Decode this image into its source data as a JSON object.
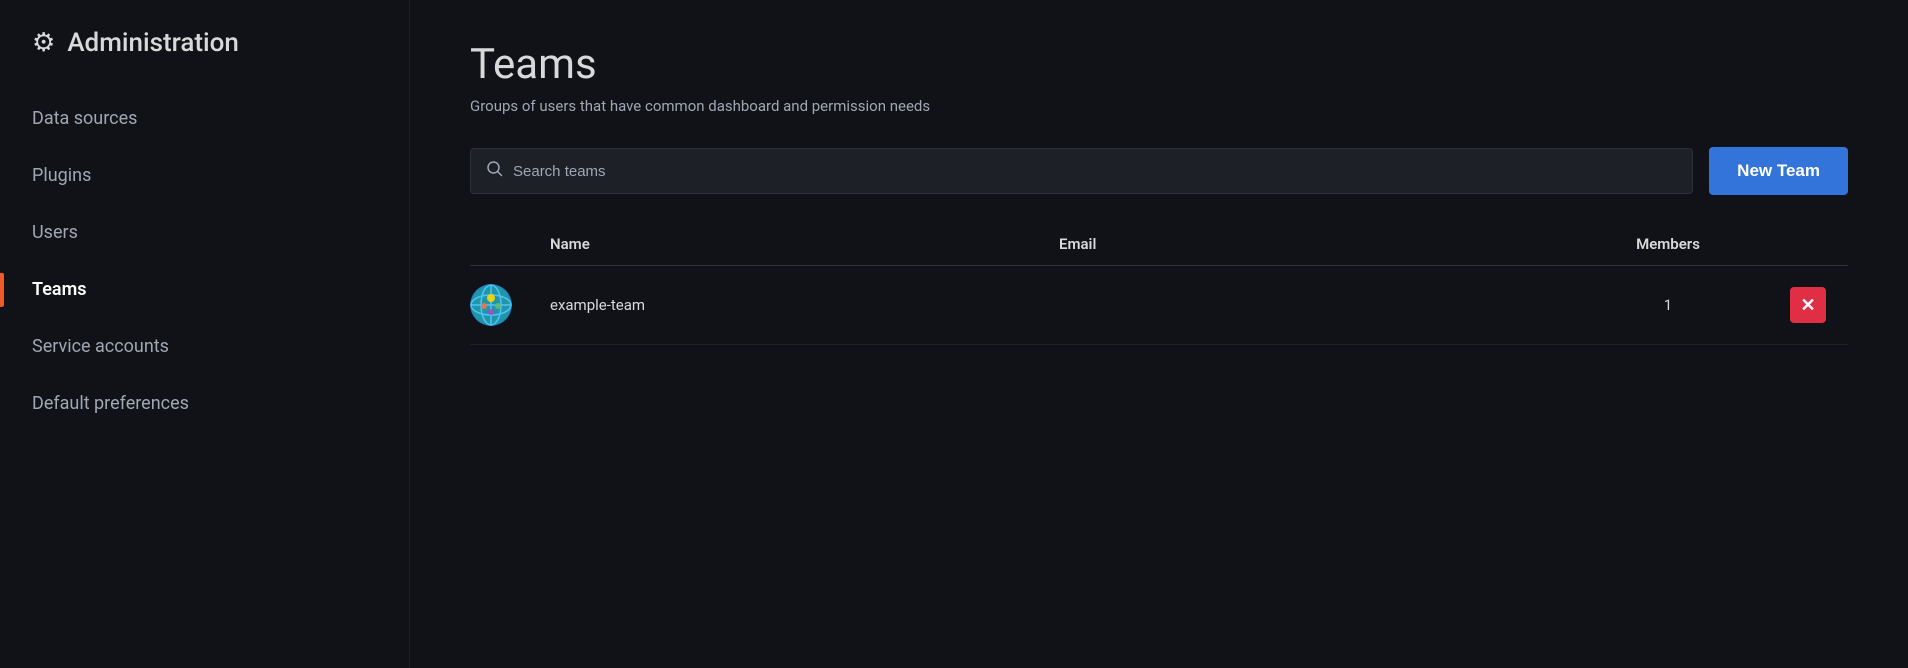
{
  "sidebar": {
    "header": {
      "title": "Administration",
      "icon": "⚙"
    },
    "items": [
      {
        "id": "data-sources",
        "label": "Data sources",
        "active": false
      },
      {
        "id": "plugins",
        "label": "Plugins",
        "active": false
      },
      {
        "id": "users",
        "label": "Users",
        "active": false
      },
      {
        "id": "teams",
        "label": "Teams",
        "active": true
      },
      {
        "id": "service-accounts",
        "label": "Service accounts",
        "active": false
      },
      {
        "id": "default-preferences",
        "label": "Default preferences",
        "active": false
      }
    ]
  },
  "main": {
    "page_title": "Teams",
    "page_subtitle": "Groups of users that have common dashboard and permission needs",
    "search_placeholder": "Search teams",
    "new_team_label": "New Team",
    "table": {
      "headers": {
        "name": "Name",
        "email": "Email",
        "members": "Members"
      },
      "rows": [
        {
          "id": 1,
          "name": "example-team",
          "email": "",
          "members": "1"
        }
      ]
    }
  }
}
